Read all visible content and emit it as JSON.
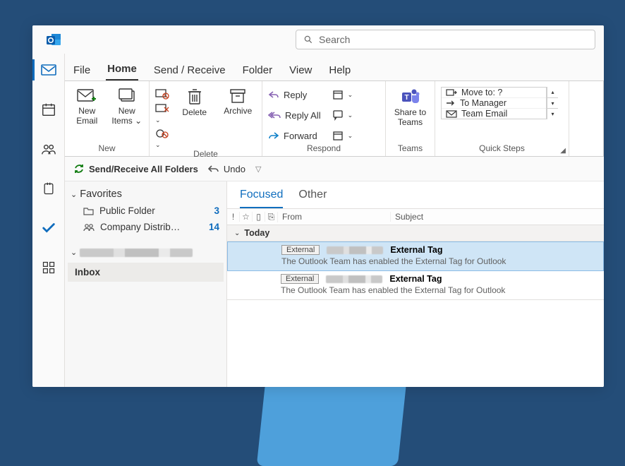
{
  "search": {
    "placeholder": "Search"
  },
  "tabs": {
    "file": "File",
    "home": "Home",
    "sendreceive": "Send / Receive",
    "folder": "Folder",
    "view": "View",
    "help": "Help"
  },
  "ribbon": {
    "new_email": "New\nEmail",
    "new_items": "New\nItems",
    "delete": "Delete",
    "archive": "Archive",
    "reply": "Reply",
    "reply_all": "Reply All",
    "forward": "Forward",
    "share_teams": "Share to\nTeams",
    "quicksteps": {
      "move_to": "Move to: ?",
      "to_manager": "To Manager",
      "team_email": "Team Email"
    },
    "group_new": "New",
    "group_delete": "Delete",
    "group_respond": "Respond",
    "group_teams": "Teams",
    "group_quicksteps": "Quick Steps"
  },
  "qat": {
    "sendreceive_all": "Send/Receive All Folders",
    "undo": "Undo"
  },
  "folders": {
    "favorites": "Favorites",
    "public_folder": "Public Folder",
    "public_count": "3",
    "company": "Company Distrib…",
    "company_count": "14",
    "inbox": "Inbox"
  },
  "maillist": {
    "focused": "Focused",
    "other": "Other",
    "col_from": "From",
    "col_subject": "Subject",
    "today": "Today",
    "external": "External",
    "subject1": "External Tag",
    "preview1": "The Outlook Team has enabled the External Tag for Outlook",
    "subject2": "External Tag",
    "preview2": "The Outlook Team has enabled the External Tag for Outlook"
  }
}
